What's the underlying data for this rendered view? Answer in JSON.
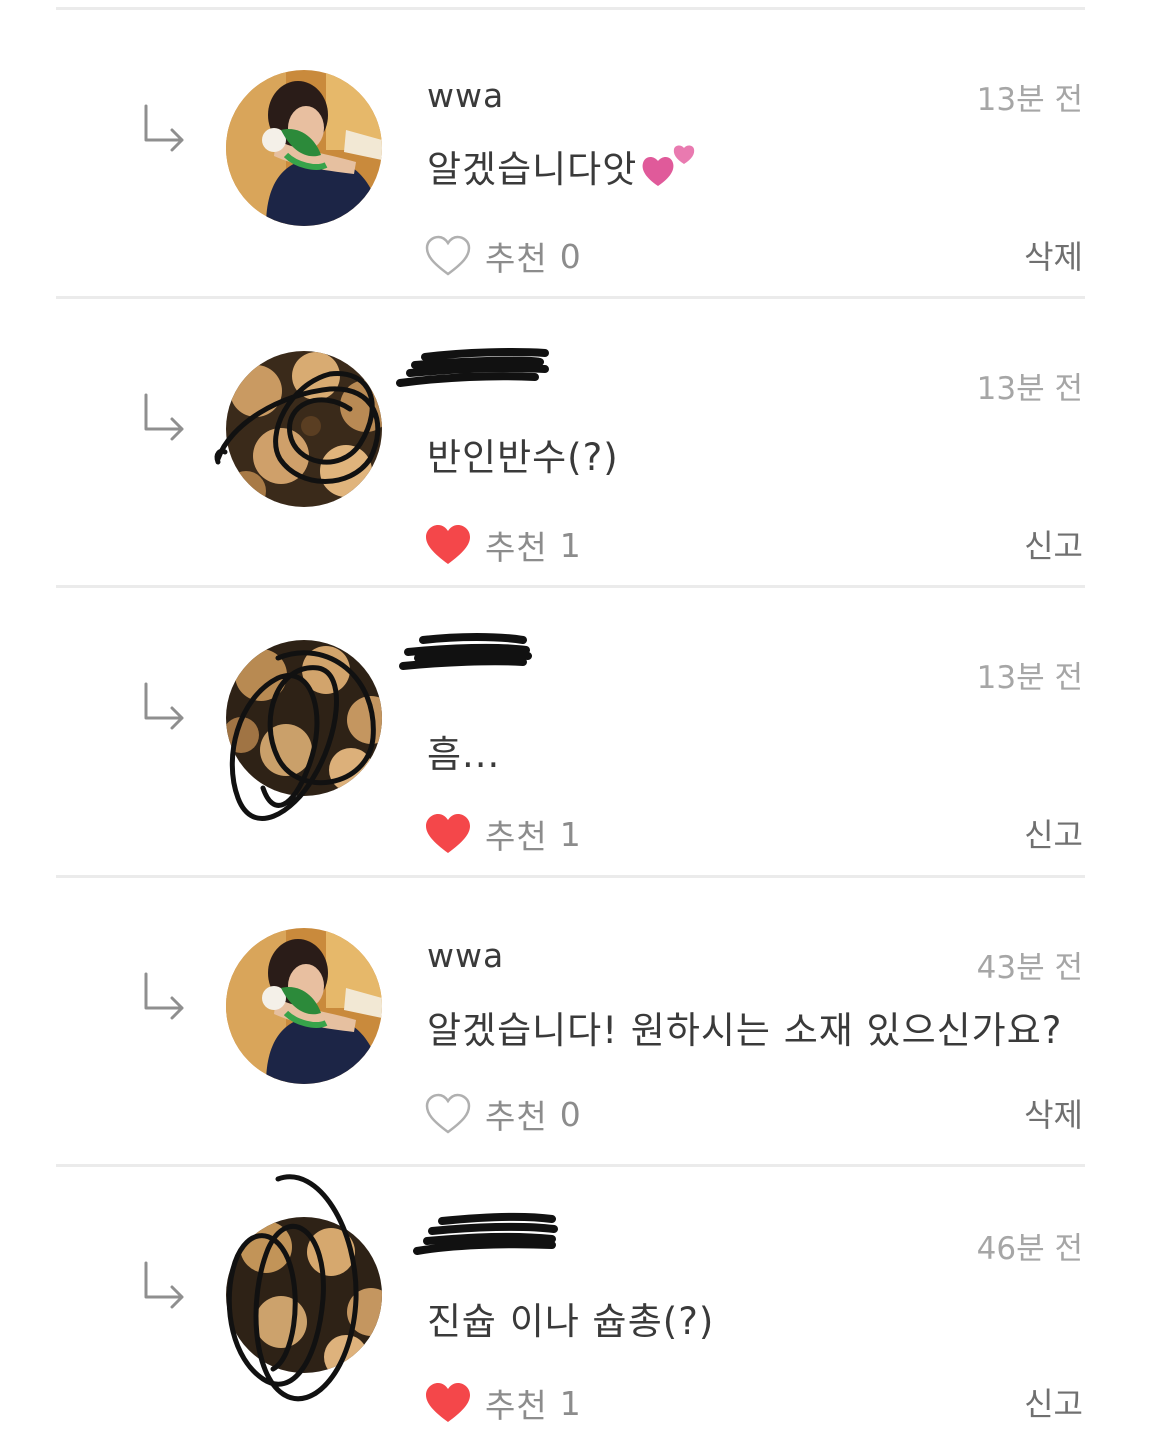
{
  "comments": [
    {
      "username": "wwa",
      "time": "13분 전",
      "message": "알겠습니다앗",
      "message_emoji": "pink-hearts-emoji",
      "like_label": "추천",
      "like_count": "0",
      "liked": false,
      "action": "삭제",
      "avatar": "person-with-flower",
      "redacted": false
    },
    {
      "username": "",
      "time": "13분 전",
      "message": "반인반수(?)",
      "like_label": "추천",
      "like_count": "1",
      "liked": true,
      "action": "신고",
      "avatar": "flowers",
      "redacted": true
    },
    {
      "username": "",
      "time": "13분 전",
      "message": "흠...",
      "like_label": "추천",
      "like_count": "1",
      "liked": true,
      "action": "신고",
      "avatar": "flowers",
      "redacted": true
    },
    {
      "username": "wwa",
      "time": "43분 전",
      "message": "알겠습니다! 원하시는 소재 있으신가요?",
      "like_label": "추천",
      "like_count": "0",
      "liked": false,
      "action": "삭제",
      "avatar": "person-with-flower",
      "redacted": false
    },
    {
      "username": "",
      "time": "46분 전",
      "message": "진슙 이나 슙총(?)",
      "like_label": "추천",
      "like_count": "1",
      "liked": true,
      "action": "신고",
      "avatar": "flowers",
      "redacted": true
    }
  ],
  "colors": {
    "liked_heart": "#f4474a",
    "outline_heart": "#b0b0b0",
    "divider": "#ebebeb",
    "time_text": "#a6a6a6",
    "body_text": "#3a3a3a",
    "emoji_pink": "#e05a9a"
  }
}
